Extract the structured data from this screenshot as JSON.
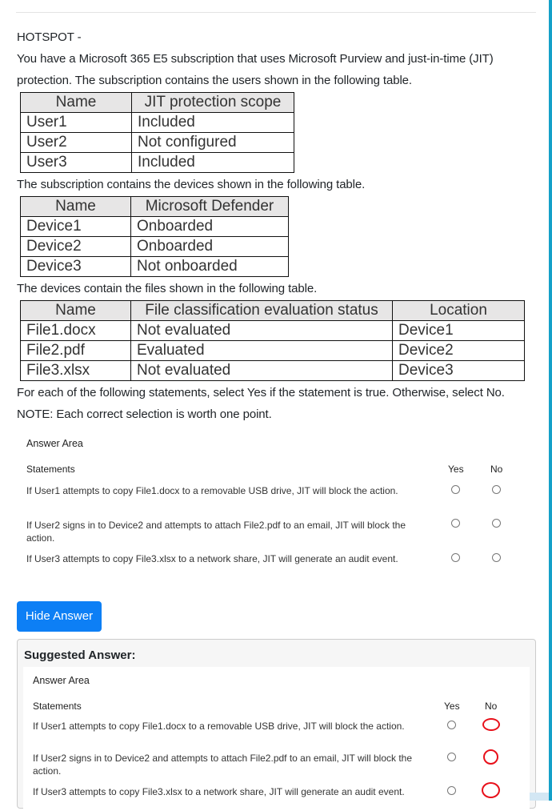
{
  "question": {
    "header": "HOTSPOT -",
    "intro_line1": "You have a Microsoft 365 E5 subscription that uses Microsoft Purview and just-in-time (JIT)",
    "intro_line2": "protection. The subscription contains the users shown in the following table.",
    "devices_intro": "The subscription contains the devices shown in the following table.",
    "files_intro": "The devices contain the files shown in the following table.",
    "instruction": "For each of the following statements, select Yes if the statement is true. Otherwise, select No.",
    "note": "NOTE: Each correct selection is worth one point."
  },
  "users_table": {
    "headers": [
      "Name",
      "JIT protection scope"
    ],
    "rows": [
      [
        "User1",
        "Included"
      ],
      [
        "User2",
        "Not configured"
      ],
      [
        "User3",
        "Included"
      ]
    ]
  },
  "devices_table": {
    "headers": [
      "Name",
      "Microsoft Defender"
    ],
    "rows": [
      [
        "Device1",
        "Onboarded"
      ],
      [
        "Device2",
        "Onboarded"
      ],
      [
        "Device3",
        "Not onboarded"
      ]
    ]
  },
  "files_table": {
    "headers": [
      "Name",
      "File classification evaluation status",
      "Location"
    ],
    "rows": [
      [
        "File1.docx",
        "Not evaluated",
        "Device1"
      ],
      [
        "File2.pdf",
        "Evaluated",
        "Device2"
      ],
      [
        "File3.xlsx",
        "Not evaluated",
        "Device3"
      ]
    ]
  },
  "answer_area": {
    "title": "Answer Area",
    "statements_header": "Statements",
    "yes_header": "Yes",
    "no_header": "No",
    "statements": [
      {
        "line1": "If User1 attempts to copy File1.docx to a removable USB drive, JIT will block the action.",
        "line2": ""
      },
      {
        "line1": "If User2 signs in to Device2 and attempts to attach File2.pdf to an email, JIT will block the",
        "line2": "action."
      },
      {
        "line1": "If User3 attempts to copy File3.xlsx to a network share, JIT will generate an audit event.",
        "line2": ""
      }
    ]
  },
  "hide_answer_button": "Hide Answer",
  "suggested_answer": {
    "title": "Suggested Answer:",
    "answer_area_title": "Answer Area",
    "statements_header": "Statements",
    "yes_header": "Yes",
    "no_header": "No",
    "selections": [
      "No",
      "No",
      "No"
    ],
    "highlight_color": "#e8101a"
  }
}
